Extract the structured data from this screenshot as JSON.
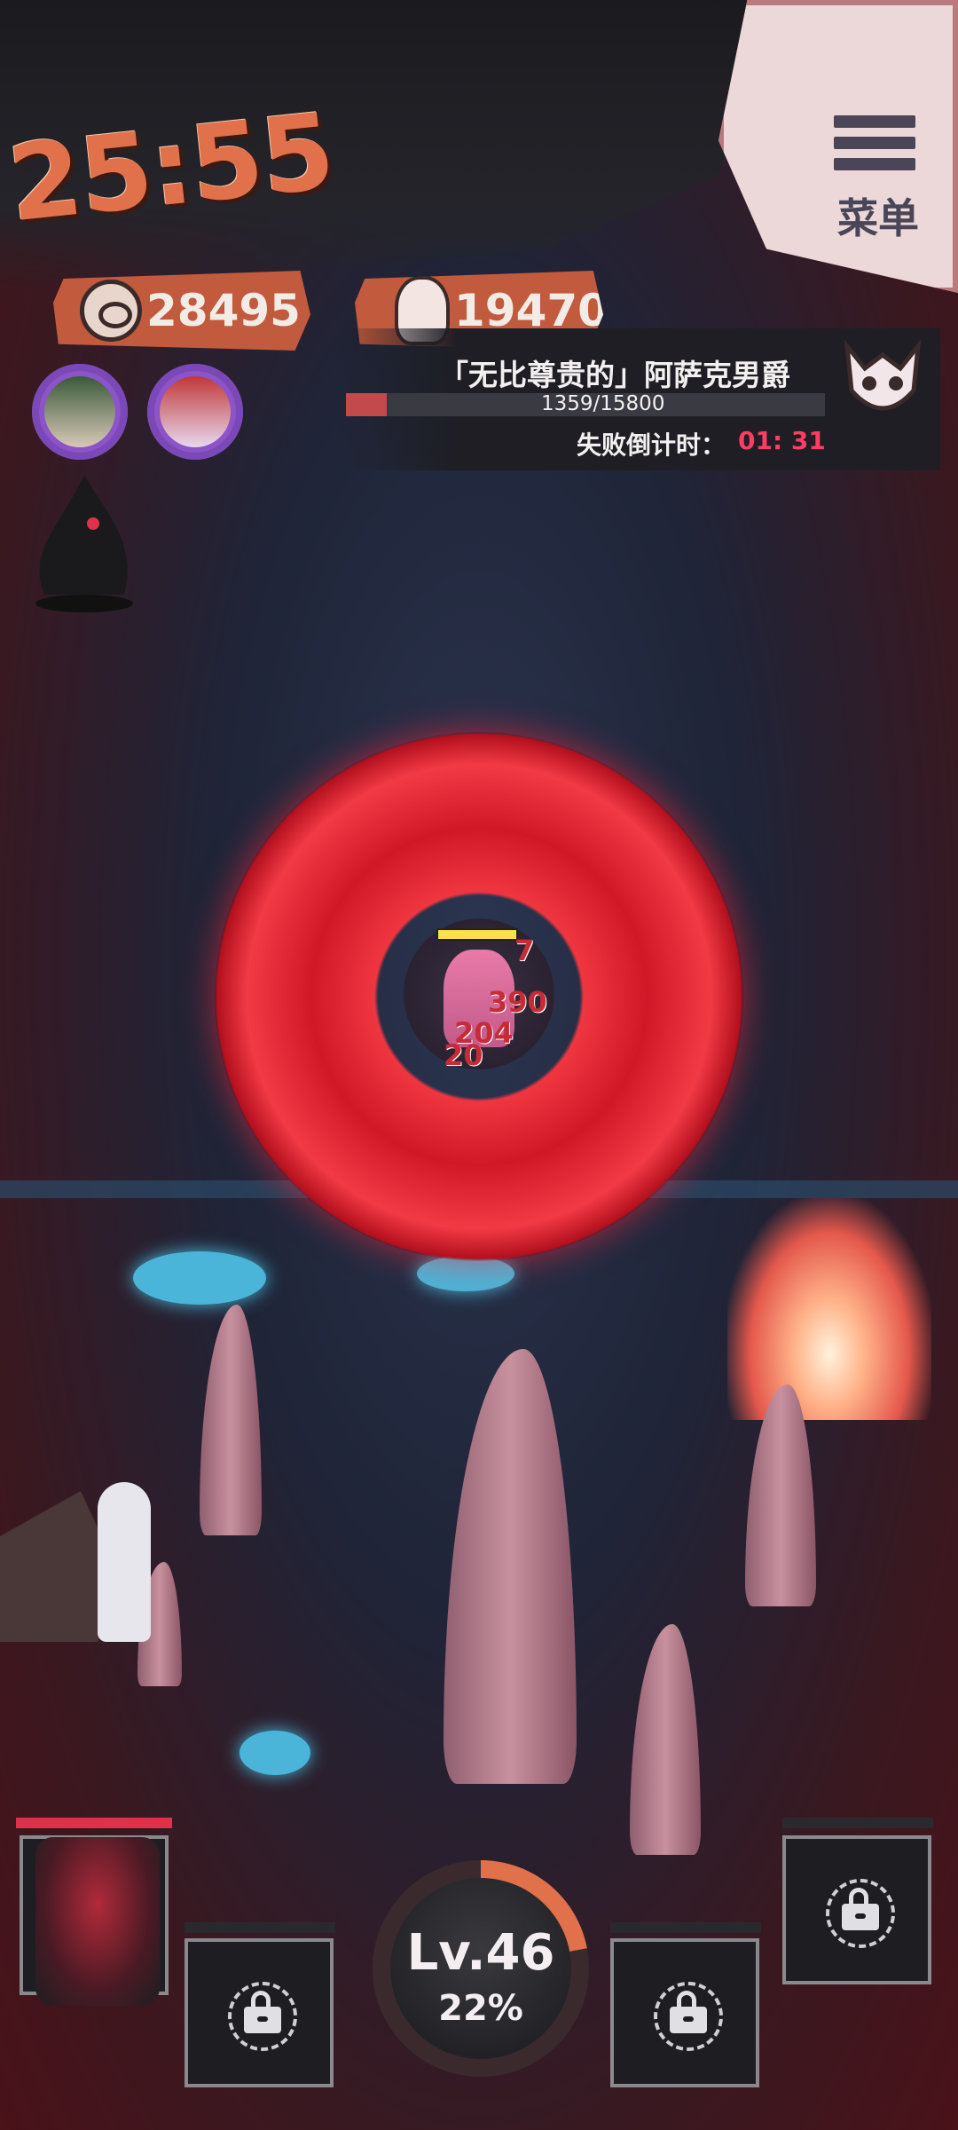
{
  "hud": {
    "timer": "25:55",
    "coins": "28495",
    "kills": "19470",
    "menu_label": "菜单"
  },
  "boss": {
    "name": "「无比尊贵的」阿萨克男爵",
    "hp_text": "1359/15800",
    "hp_fraction": 0.086,
    "fail_countdown_label": "失败倒计时：",
    "fail_countdown_value": "01: 31"
  },
  "combat": {
    "damage_numbers": [
      "7",
      "390",
      "204",
      "20"
    ]
  },
  "level": {
    "label": "Lv.46",
    "progress_text": "22%",
    "progress_fraction": 0.22
  },
  "colors": {
    "accent": "#e0714a",
    "countdown": "#ff3c62",
    "portrait_ring": "#8c54c8",
    "aura": "#ef3640"
  },
  "icons": {
    "coin": "coin-icon",
    "kill": "skull-icon",
    "menu": "menu-icon",
    "lock": "lock-icon",
    "boss": "boss-emblem-icon"
  }
}
